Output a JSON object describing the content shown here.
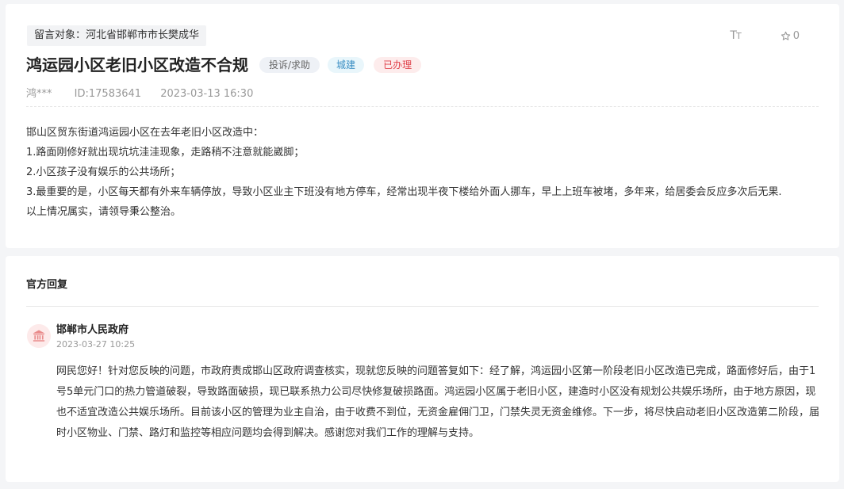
{
  "message": {
    "target_label": "留言对象：河北省邯郸市市长樊成华",
    "title": "鸿运园小区老旧小区改造不合规",
    "tags": {
      "type": "投诉/求助",
      "category": "城建",
      "status": "已办理"
    },
    "author": "鸿***",
    "id": "ID:17583641",
    "datetime": "2023-03-13 16:30",
    "font_size_label": "Tт",
    "star_count": "0",
    "content_lines": [
      "邯山区贸东街道鸿运园小区在去年老旧小区改造中：",
      "1.路面刚修好就出现坑坑洼洼现象，走路稍不注意就能崴脚；",
      "2.小区孩子没有娱乐的公共场所；",
      "3.最重要的是，小区每天都有外来车辆停放，导致小区业主下班没有地方停车，经常出现半夜下楼给外面人挪车，早上上班车被堵，多年来，给居委会反应多次后无果.",
      "以上情况属实，请领导秉公整治。"
    ]
  },
  "reply": {
    "heading": "官方回复",
    "org_name": "邯郸市人民政府",
    "datetime": "2023-03-27 10:25",
    "text": "网民您好！针对您反映的问题，市政府责成邯山区政府调查核实，现就您反映的问题答复如下：经了解，鸿运园小区第一阶段老旧小区改造已完成，路面修好后，由于1号5单元门口的热力管道破裂，导致路面破损，现已联系热力公司尽快修复破损路面。鸿运园小区属于老旧小区，建造时小区没有规划公共娱乐场所，由于地方原因，现也不适宜改造公共娱乐场所。目前该小区的管理为业主自治，由于收费不到位，无资金雇佣门卫，门禁失灵无资金维修。下一步，将尽快启动老旧小区改造第二阶段，届时小区物业、门禁、路灯和监控等相应问题均会得到解决。感谢您对我们工作的理解与支持。"
  },
  "colors": {
    "status_red": "#e0424b",
    "category_blue": "#3b8fc4",
    "avatar_bg": "#fdeaea",
    "avatar_icon": "#e98b8b"
  }
}
